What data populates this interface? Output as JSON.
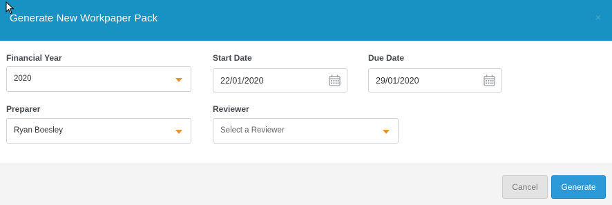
{
  "dialog": {
    "title": "Generate New Workpaper Pack",
    "close_symbol": "×"
  },
  "form": {
    "financial_year": {
      "label": "Financial Year",
      "value": "2020"
    },
    "start_date": {
      "label": "Start Date",
      "value": "22/01/2020"
    },
    "due_date": {
      "label": "Due Date",
      "value": "29/01/2020"
    },
    "preparer": {
      "label": "Preparer",
      "value": "Ryan Boesley"
    },
    "reviewer": {
      "label": "Reviewer",
      "placeholder": "Select a Reviewer"
    }
  },
  "footer": {
    "cancel_label": "Cancel",
    "generate_label": "Generate"
  },
  "colors": {
    "header_bg": "#1892c3",
    "caret": "#e8962e",
    "primary_button": "#2d9ad8"
  },
  "icons": [
    "close-icon",
    "calendar-icon",
    "chevron-down-icon",
    "mouse-cursor-icon"
  ]
}
